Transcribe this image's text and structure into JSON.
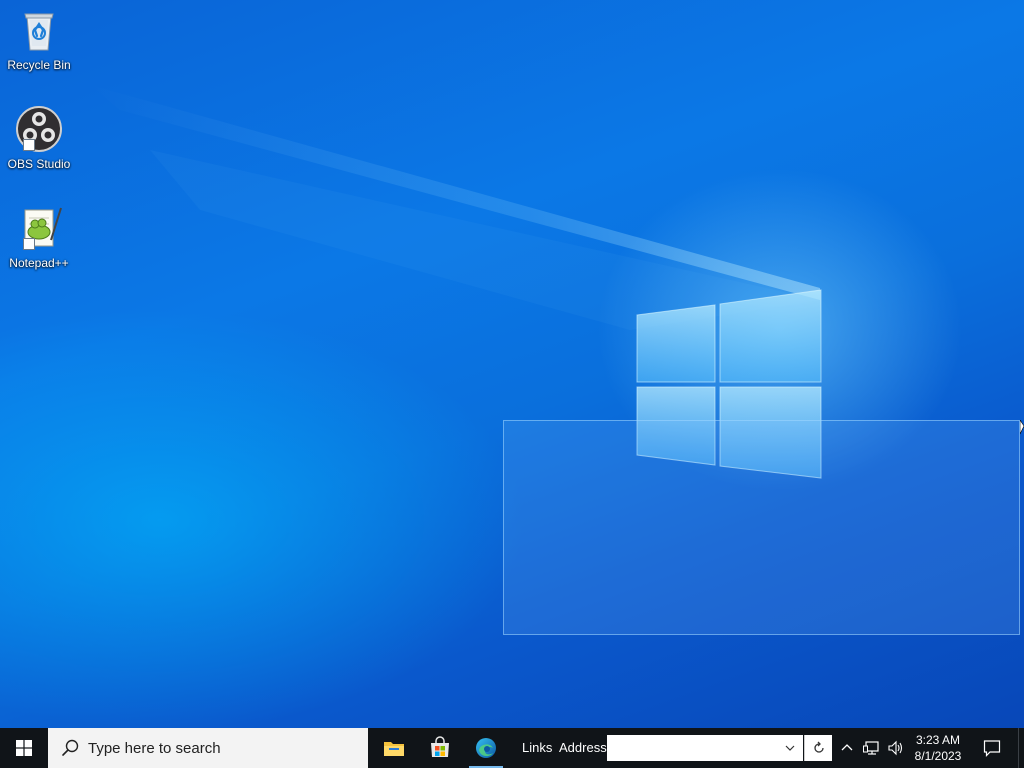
{
  "desktop": {
    "icons": [
      {
        "label": "Recycle Bin",
        "icon": "recycle-bin-icon"
      },
      {
        "label": "OBS Studio",
        "icon": "obs-studio-icon"
      },
      {
        "label": "Notepad++",
        "icon": "notepad-plus-plus-icon"
      }
    ],
    "colors": {
      "wallpaper_light": "#1ea8ff",
      "wallpaper_dark": "#0847b8",
      "logo": "#8fd8ff"
    }
  },
  "taskbar": {
    "start_icon": "windows-logo-icon",
    "search": {
      "placeholder": "Type here to search",
      "icon": "search-icon"
    },
    "apps": [
      {
        "name": "File Explorer",
        "icon": "file-explorer-icon"
      },
      {
        "name": "Microsoft Store",
        "icon": "microsoft-store-icon"
      },
      {
        "name": "Microsoft Edge",
        "icon": "edge-icon",
        "active": true
      }
    ],
    "toolbars": {
      "links_label": "Links",
      "address_label": "Address",
      "address_value": ""
    },
    "tray": {
      "icons": [
        "chevron-up-icon",
        "network-icon",
        "volume-icon"
      ]
    },
    "clock": {
      "time": "3:23 AM",
      "date": "8/1/2023"
    },
    "notifications_icon": "notification-icon",
    "colors": {
      "background": "#101418",
      "active_indicator": "#76b9ed",
      "search_bg": "#f3f3f3"
    }
  }
}
